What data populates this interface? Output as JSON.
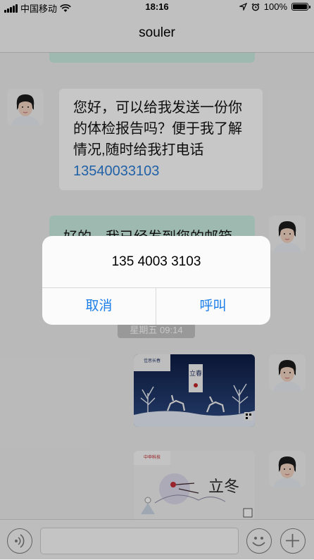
{
  "status_bar": {
    "carrier": "中国移动",
    "time": "18:16",
    "battery_text": "100%",
    "battery_level": 1.0,
    "icons": [
      "signal-bars-icon",
      "wifi-icon",
      "location-arrow-icon",
      "alarm-icon",
      "battery-icon"
    ]
  },
  "nav": {
    "title": "souler"
  },
  "messages": [
    {
      "direction": "incoming",
      "lines": [
        "您好，可以给我发送一份你",
        "的体检报告吗？便于我了解",
        "情况,随时给我打电话"
      ],
      "phone": "13540033103"
    },
    {
      "direction": "outgoing",
      "text": "好的，我已经发到您的邮箱"
    }
  ],
  "timestamp": "星期五 09:14",
  "images": [
    {
      "name": "lichun-card",
      "brand": "佳思长春",
      "title": "立春"
    },
    {
      "name": "lidong-card",
      "brand": "中申科技",
      "title": "立冬"
    }
  ],
  "alert": {
    "message": "135 4003 3103",
    "cancel_label": "取消",
    "call_label": "呼叫"
  },
  "colors": {
    "link_blue": "#2b7dd6",
    "alert_button_blue": "#1a7ee8",
    "outgoing_bubble": "#cbeee0"
  }
}
